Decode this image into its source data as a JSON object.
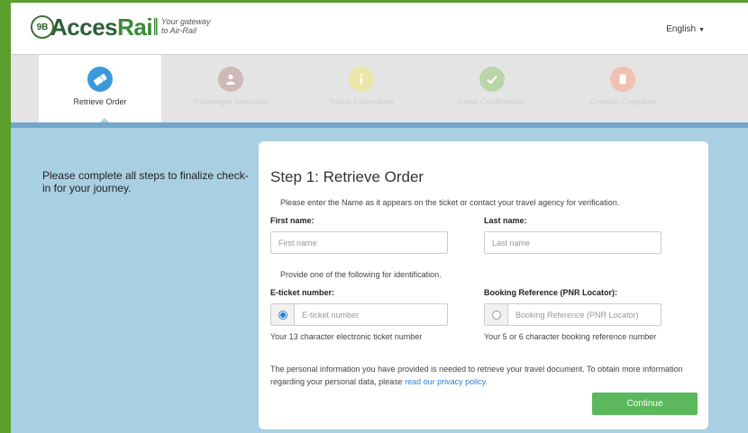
{
  "header": {
    "logo_badge": "9B",
    "logo_text_a": "Acces",
    "logo_text_b": "Rail",
    "tagline_line1": "Your gateway",
    "tagline_line2": "to Air-Rail",
    "language": "English"
  },
  "steps": [
    {
      "label": "Retrieve Order",
      "icon": "ticket-icon",
      "state": "active"
    },
    {
      "label": "Passenger Selection",
      "icon": "person-icon",
      "state": "pending"
    },
    {
      "label": "Travel Information",
      "icon": "info-icon",
      "state": "pending"
    },
    {
      "label": "Email Confirmation",
      "icon": "check-icon",
      "state": "pending"
    },
    {
      "label": "Checkin Complete",
      "icon": "mobile-icon",
      "state": "pending"
    }
  ],
  "intro": "Please complete all steps to finalize check-in for your journey.",
  "form": {
    "title": "Step 1: Retrieve Order",
    "instruction": "Please enter the Name as it appears on the ticket or contact your travel agency for verification.",
    "first_name_label": "First name:",
    "first_name_placeholder": "First name",
    "first_name_value": "",
    "last_name_label": "Last name:",
    "last_name_placeholder": "Last name",
    "last_name_value": "",
    "provide": "Provide one of the following for identification.",
    "eticket_label": "E-ticket number:",
    "eticket_placeholder": "E-ticket number",
    "eticket_selected": true,
    "eticket_hint": "Your 13 character electronic ticket number",
    "booking_label": "Booking Reference (PNR Locator):",
    "booking_placeholder": "Booking Reference (PNR Locator)",
    "booking_selected": false,
    "booking_hint": "Your 5 or 6 character booking reference number",
    "privacy_text": "The personal information you have provided is needed to retrieve your travel document. To obtain more information regarding your personal data, please ",
    "privacy_link": "read our privacy policy",
    "privacy_end": ".",
    "continue": "Continue"
  },
  "colors": {
    "frame": "#5a9e2c",
    "main_bg": "#a9cfe3",
    "active_step": "#3a9ad9",
    "button": "#5cb85c",
    "link": "#2d7fd6",
    "step_icons_dim": [
      "#d0b8b8",
      "#ece6a8",
      "#b8d6a8",
      "#f0c0b0"
    ]
  }
}
